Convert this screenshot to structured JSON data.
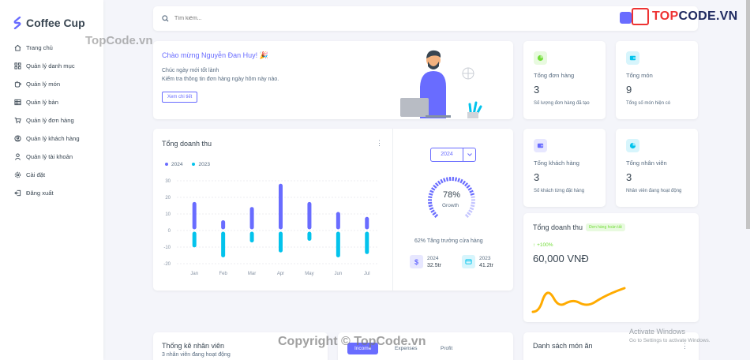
{
  "brand": {
    "name": "Coffee Cup"
  },
  "sidebar": {
    "items": [
      {
        "label": "Trang chủ",
        "icon": "home-icon"
      },
      {
        "label": "Quản lý danh mục",
        "icon": "grid-icon"
      },
      {
        "label": "Quản lý món",
        "icon": "cup-icon"
      },
      {
        "label": "Quản lý bàn",
        "icon": "table-icon"
      },
      {
        "label": "Quản lý đơn hàng",
        "icon": "cart-icon"
      },
      {
        "label": "Quản lý khách hàng",
        "icon": "user-circle-icon"
      },
      {
        "label": "Quản lý tài khoản",
        "icon": "user-icon"
      },
      {
        "label": "Cài đặt",
        "icon": "gear-icon"
      },
      {
        "label": "Đăng xuất",
        "icon": "logout-icon"
      }
    ]
  },
  "search": {
    "placeholder": "Tìm kiếm..."
  },
  "watermark": {
    "logo_text_1": "TOP",
    "logo_text_2": "CODE.VN",
    "site": "TopCode.vn",
    "copyright": "Copyright © TopCode.vn"
  },
  "welcome": {
    "title": "Chào mừng Nguyễn Đan Huy! 🎉",
    "line1": "Chúc ngày mới tốt lành",
    "line2": "Kiểm tra thông tin đơn hàng ngày hôm này nào.",
    "button": "Xem chi tiết"
  },
  "stats": [
    {
      "label": "Tổng đơn hàng",
      "value": "3",
      "sub": "Số lượng đơn hàng đã tạo",
      "color": "#71dd37"
    },
    {
      "label": "Tổng món",
      "value": "9",
      "sub": "Tổng số món hiện có",
      "color": "#03c3ec"
    },
    {
      "label": "Tổng khách hàng",
      "value": "3",
      "sub": "Số khách từng đặt hàng",
      "color": "#696cff"
    },
    {
      "label": "Tổng nhân viên",
      "value": "3",
      "sub": "Nhân viên đang hoạt động",
      "color": "#03c3ec"
    }
  ],
  "revenue": {
    "title": "Tổng doanh thu",
    "year_selected": "2024",
    "growth_percent": "78%",
    "growth_label": "Growth",
    "growth_value": 0.78,
    "growth_text": "62% Tăng trưởng cửa hàng",
    "years": [
      {
        "year": "2024",
        "value": "32.5tr"
      },
      {
        "year": "2023",
        "value": "41.2tr"
      }
    ]
  },
  "chart_data": {
    "type": "bar",
    "categories": [
      "Jan",
      "Feb",
      "Mar",
      "Apr",
      "May",
      "Jun",
      "Jul"
    ],
    "series": [
      {
        "name": "2024",
        "values": [
          16,
          5,
          13,
          27,
          16,
          10,
          7
        ],
        "color": "#696cff"
      },
      {
        "name": "2023",
        "values": [
          -9,
          -15,
          -6,
          -12,
          -5,
          -15,
          -13
        ],
        "color": "#03c3ec"
      }
    ],
    "yticks": [
      30,
      20,
      10,
      0,
      -10,
      -20
    ],
    "ylim": [
      -20,
      30
    ],
    "grid": true,
    "legend": "top-left"
  },
  "total_revenue": {
    "title": "Tổng doanh thu",
    "badge": "Đơn hàng hoàn tất",
    "change": "+100%",
    "value": "60,000 VNĐ",
    "line_color": "#ffab00"
  },
  "bottom": {
    "staff_title": "Thống kê nhân viên",
    "staff_sub": "3 nhân viên đang hoạt động",
    "tabs": [
      "Income",
      "Expenses",
      "Profit"
    ],
    "menu_title": "Danh sách món ăn"
  },
  "windows": {
    "title": "Activate Windows",
    "sub": "Go to Settings to activate Windows."
  }
}
